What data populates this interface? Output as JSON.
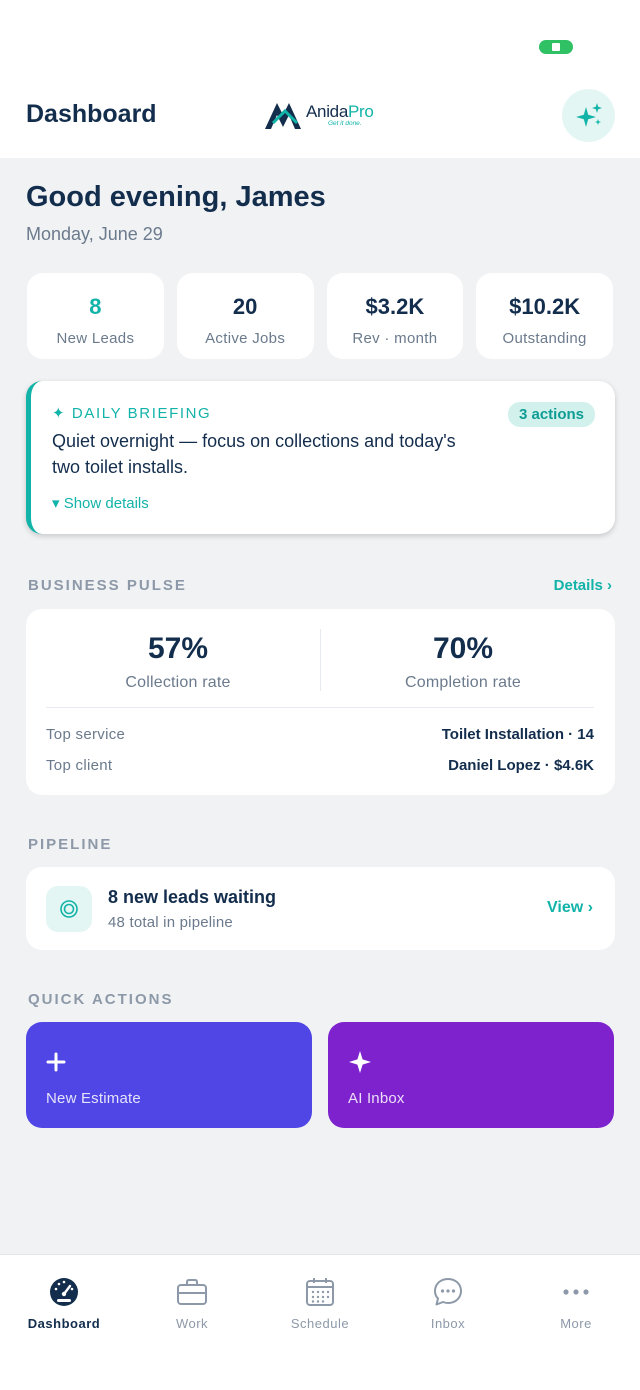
{
  "header": {
    "title": "Dashboard",
    "logo_name": "Anida",
    "logo_name_accent": "Pro",
    "logo_tagline": "Get it done.",
    "ai_icon": "sparkles-icon"
  },
  "greeting": "Good evening, James",
  "date": "Monday, June 29",
  "stats": [
    {
      "value": "8",
      "label": "New Leads"
    },
    {
      "value": "20",
      "label": "Active Jobs"
    },
    {
      "value": "$3.2K",
      "label": "Rev · month"
    },
    {
      "value": "$10.2K",
      "label": "Outstanding"
    }
  ],
  "briefing": {
    "label": "✦ DAILY BRIEFING",
    "badge": "3 actions",
    "text": "Quiet overnight — focus on collections and today's two toilet installs.",
    "toggle": "▾ Show details"
  },
  "pulse": {
    "title": "BUSINESS PULSE",
    "link": "Details ›",
    "collection_value": "57%",
    "collection_label": "Collection rate",
    "completion_value": "70%",
    "completion_label": "Completion rate",
    "top_service_label": "Top service",
    "top_service_value": "Toilet Installation · 14",
    "top_client_label": "Top client",
    "top_client_value": "Daniel Lopez · $4.6K"
  },
  "pipeline": {
    "title": "PIPELINE",
    "headline": "8 new leads waiting",
    "sub": "48 total in pipeline",
    "view": "View ›"
  },
  "quick_actions": {
    "title": "QUICK ACTIONS",
    "estimate_label": "New Estimate",
    "inbox_label": "AI Inbox"
  },
  "tabs": [
    {
      "label": "Dashboard",
      "icon": "speedometer-icon",
      "active": true
    },
    {
      "label": "Work",
      "icon": "briefcase-icon",
      "active": false
    },
    {
      "label": "Schedule",
      "icon": "calendar-icon",
      "active": false
    },
    {
      "label": "Inbox",
      "icon": "chat-bubble-icon",
      "active": false
    },
    {
      "label": "More",
      "icon": "more-dots-icon",
      "active": false
    }
  ],
  "colors": {
    "accent": "#12b3a8",
    "navy": "#132d4d",
    "estimate": "#4f46e5",
    "ai_inbox": "#7e22ce"
  }
}
